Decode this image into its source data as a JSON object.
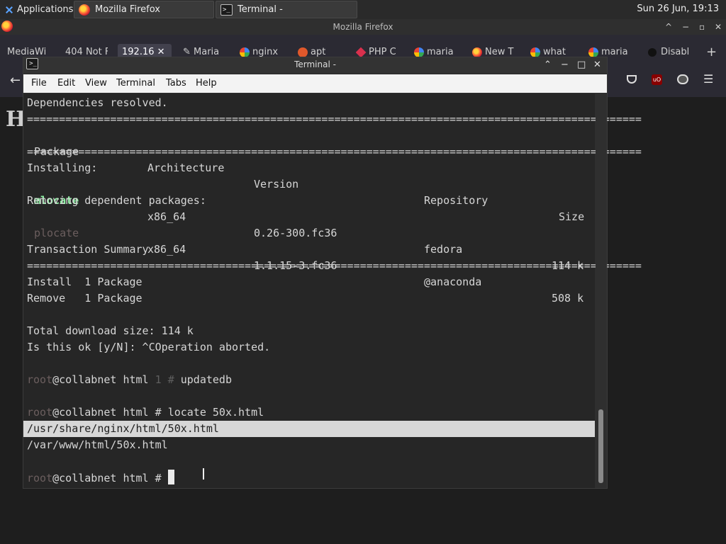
{
  "panel": {
    "applications": "Applications",
    "tasks": [
      "Mozilla Firefox",
      "Terminal -"
    ],
    "clock": "Sun 26 Jun, 19:13"
  },
  "firefox": {
    "title": "Mozilla Firefox",
    "tabs": [
      "MediaWi",
      "404 Not F",
      "192.16",
      "Maria",
      "nginx",
      "apt",
      "PHP C",
      "maria",
      "New T",
      "what",
      "maria",
      "Disabl"
    ],
    "heading": "H"
  },
  "terminal": {
    "title": "Terminal -",
    "menu": [
      "File",
      "Edit",
      "View",
      "Terminal",
      "Tabs",
      "Help"
    ],
    "separator": "================================================================================================",
    "header": {
      "package": "Package",
      "arch": "Architecture",
      "version": "Version",
      "repo": "Repository",
      "size": "Size"
    },
    "deps_resolved": "Dependencies resolved.",
    "installing_label": "Installing:",
    "install_row": {
      "package": "mlocate",
      "arch": "x86_64",
      "version": "0.26-300.fc36",
      "repo": "fedora",
      "size": "114 k"
    },
    "removing_label": "Removing dependent packages:",
    "remove_row": {
      "package": "plocate",
      "arch": "x86_64",
      "version": "1.1.15-3.fc36",
      "repo": "@anaconda",
      "size": "508 k"
    },
    "summary_label": "Transaction Summary",
    "install_count": "Install  1 Package",
    "remove_count": "Remove   1 Package",
    "download_size": "Total download size: 114 k",
    "confirm": "Is this ok [y/N]: ^COperation aborted.",
    "prompt_user": "root",
    "prompt_host": "@collabnet html ",
    "prompt_status": "1",
    "prompt_hash": "# ",
    "cmd_updatedb": "updatedb",
    "cmd_locate": "locate 50x.html",
    "result_1": "/usr/share/nginx/html/50x.html",
    "result_2": "/var/www/html/50x.html"
  }
}
